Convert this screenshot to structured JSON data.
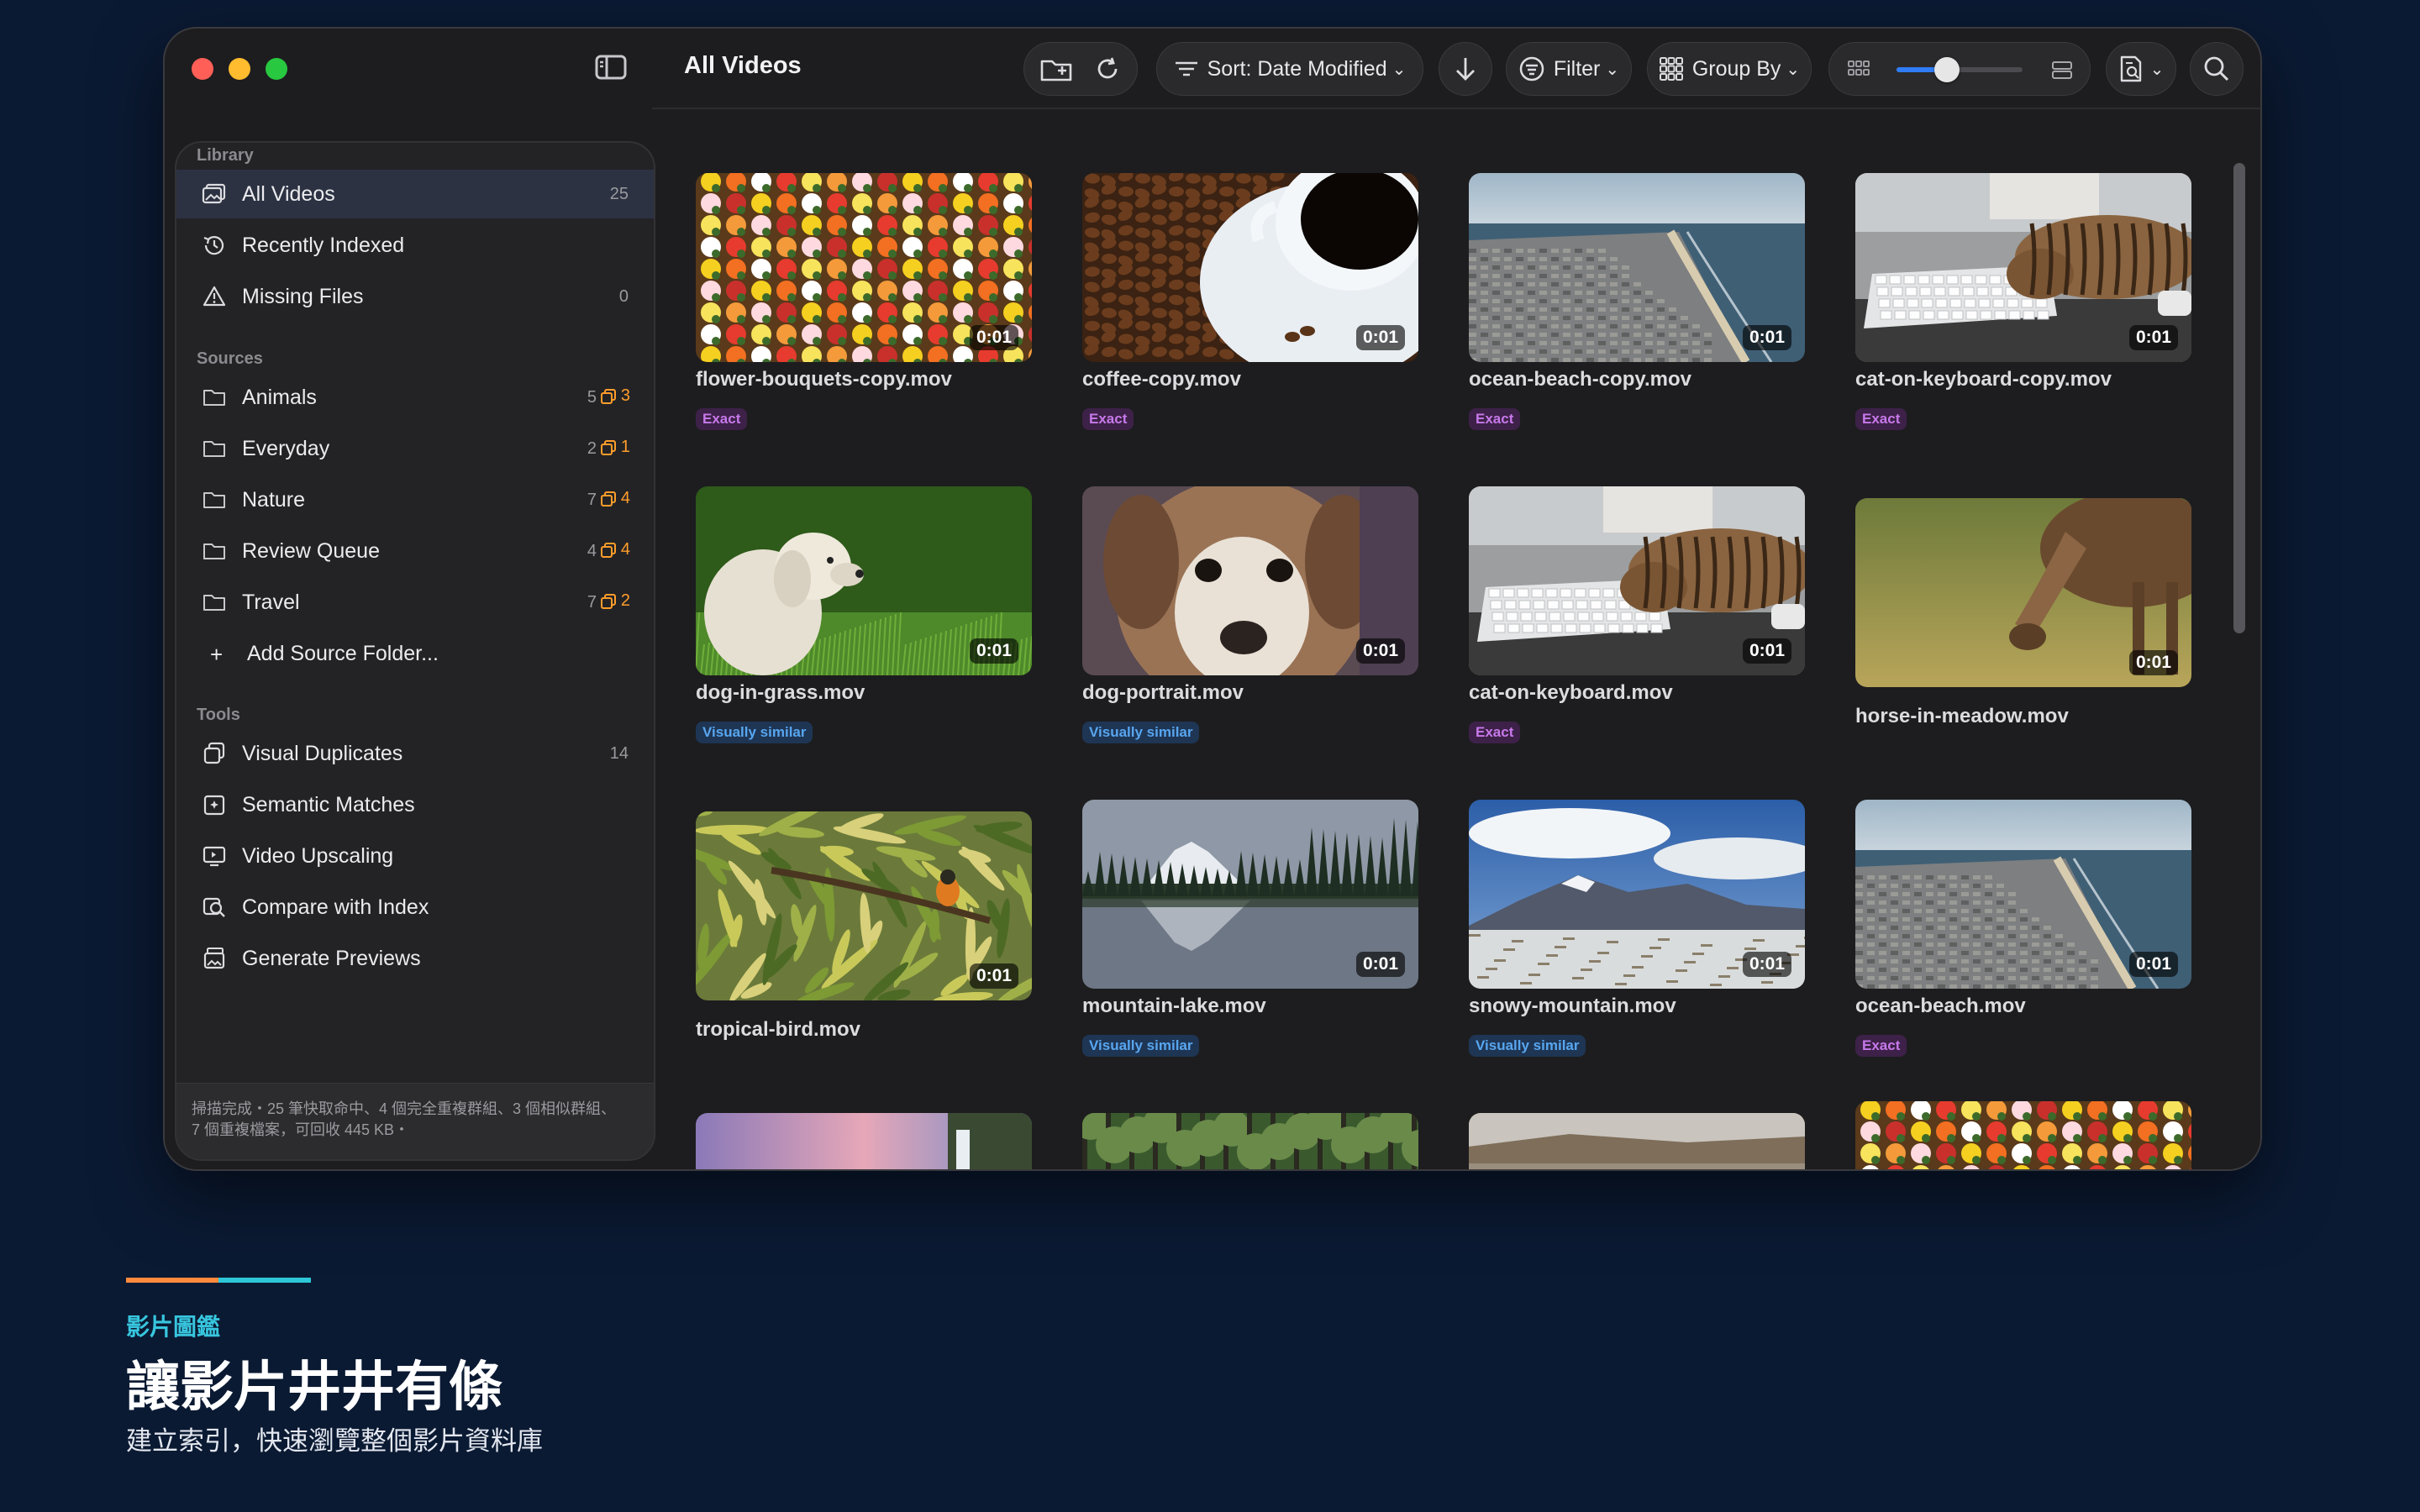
{
  "window": {
    "title": "All Videos",
    "toolbar": {
      "sort_label": "Sort: Date Modified",
      "filter_label": "Filter",
      "group_label": "Group By",
      "zoom_level": 0.4
    }
  },
  "sidebar": {
    "library_title": "Library",
    "library": [
      {
        "label": "All Videos",
        "count": "25",
        "icon": "photo-stack-icon"
      },
      {
        "label": "Recently Indexed",
        "count": "",
        "icon": "clock-history-icon"
      },
      {
        "label": "Missing Files",
        "count": "0",
        "icon": "warning-triangle-icon"
      }
    ],
    "sources_title": "Sources",
    "sources": [
      {
        "label": "Animals",
        "count": "5",
        "dups": "3"
      },
      {
        "label": "Everyday",
        "count": "2",
        "dups": "1"
      },
      {
        "label": "Nature",
        "count": "7",
        "dups": "4"
      },
      {
        "label": "Review Queue",
        "count": "4",
        "dups": "4"
      },
      {
        "label": "Travel",
        "count": "7",
        "dups": "2"
      }
    ],
    "add_source_label": "Add Source Folder...",
    "tools_title": "Tools",
    "tools": [
      {
        "label": "Visual Duplicates",
        "count": "14",
        "icon": "duplicate-icon"
      },
      {
        "label": "Semantic Matches",
        "count": "",
        "icon": "semantic-icon"
      },
      {
        "label": "Video Upscaling",
        "count": "",
        "icon": "upscale-icon"
      },
      {
        "label": "Compare with Index",
        "count": "",
        "icon": "compare-icon"
      },
      {
        "label": "Generate Previews",
        "count": "",
        "icon": "preview-icon"
      }
    ],
    "status_text": "掃描完成・25 筆快取命中、4 個完全重複群組、3 個相似群組、7 個重複檔案，可回收 445 KB・"
  },
  "videos": [
    {
      "name": "flower-bouquets-copy.mov",
      "duration": "0:01",
      "tag": "Exact",
      "thumb": "flowers"
    },
    {
      "name": "coffee-copy.mov",
      "duration": "0:01",
      "tag": "Exact",
      "thumb": "coffee"
    },
    {
      "name": "ocean-beach-copy.mov",
      "duration": "0:01",
      "tag": "Exact",
      "thumb": "ocean"
    },
    {
      "name": "cat-on-keyboard-copy.mov",
      "duration": "0:01",
      "tag": "Exact",
      "thumb": "cat"
    },
    {
      "name": "dog-in-grass.mov",
      "duration": "0:01",
      "tag": "Visually similar",
      "thumb": "dog-grass"
    },
    {
      "name": "dog-portrait.mov",
      "duration": "0:01",
      "tag": "Visually similar",
      "thumb": "dog-portrait"
    },
    {
      "name": "cat-on-keyboard.mov",
      "duration": "0:01",
      "tag": "Exact",
      "thumb": "cat"
    },
    {
      "name": "horse-in-meadow.mov",
      "duration": "0:01",
      "tag": "",
      "thumb": "horse"
    },
    {
      "name": "tropical-bird.mov",
      "duration": "0:01",
      "tag": "",
      "thumb": "bird"
    },
    {
      "name": "mountain-lake.mov",
      "duration": "0:01",
      "tag": "Visually similar",
      "thumb": "lake"
    },
    {
      "name": "snowy-mountain.mov",
      "duration": "0:01",
      "tag": "Visually similar",
      "thumb": "snow"
    },
    {
      "name": "ocean-beach.mov",
      "duration": "0:01",
      "tag": "Exact",
      "thumb": "ocean"
    },
    {
      "name": "",
      "duration": "",
      "tag": "",
      "thumb": "waterfall"
    },
    {
      "name": "",
      "duration": "",
      "tag": "",
      "thumb": "forest"
    },
    {
      "name": "",
      "duration": "",
      "tag": "",
      "thumb": "desert"
    },
    {
      "name": "",
      "duration": "",
      "tag": "",
      "thumb": "flowers"
    }
  ],
  "promo": {
    "kicker": "影片圖鑑",
    "title": "讓影片井井有條",
    "subtitle": "建立索引，快速瀏覽整個影片資料庫"
  },
  "colors": {
    "background": "#0b1a33",
    "exact_tag": "#c779ea",
    "similar_tag": "#58a6ef",
    "duplicate_badge": "#ff9d2a",
    "accent": "#2f7cf6"
  }
}
